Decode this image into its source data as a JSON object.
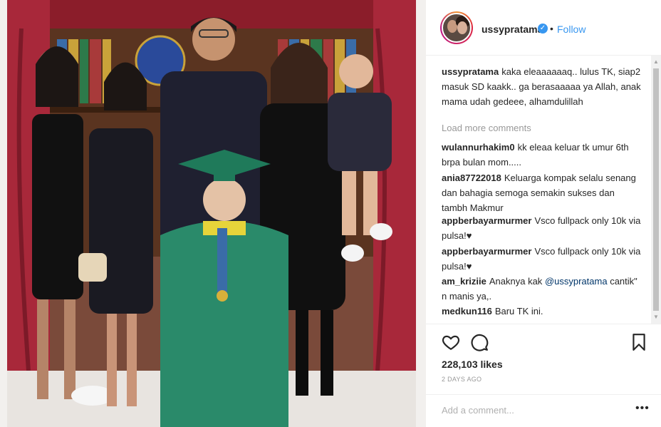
{
  "post": {
    "username": "ussypratama",
    "verified_icon": "verified-badge-icon",
    "follow_label": "Follow",
    "separator": "•"
  },
  "comments": [
    {
      "user": "ussypratama",
      "text": "kaka eleaaaaaaq.. lulus TK, siap2 masuk SD kaakk.. ga berasaaaaa ya Allah, anak mama udah gedeee, alhamdulillah"
    },
    {
      "user": "wulannurhakim0",
      "text": "kk eleaa keluar tk umur 6th brpa bulan mom....."
    },
    {
      "user": "ania87722018",
      "text": "Keluarga kompak selalu senang dan bahagia semoga semakin sukses dan tambh Makmur"
    },
    {
      "user": "appberbayarmurmer",
      "text": "Vsco fullpack only 10k via pulsa!♥"
    },
    {
      "user": "appberbayarmurmer",
      "text": "Vsco fullpack only 10k via pulsa!♥"
    },
    {
      "user": "am_kriziie",
      "text_before": "Anaknya kak",
      "mention": "@ussypratama",
      "text_after": "cantik\" n manis ya,."
    },
    {
      "user": "medkun116",
      "text": "Baru TK ini."
    }
  ],
  "load_more_label": "Load more comments",
  "actions": {
    "like_icon": "heart-icon",
    "comment_icon": "comment-bubble-icon",
    "save_icon": "bookmark-icon",
    "likes_text": "228,103 likes",
    "time_ago": "2 DAYS AGO"
  },
  "add_comment": {
    "placeholder": "Add a comment...",
    "more_label": "•••"
  },
  "colors": {
    "link_blue": "#3897f0",
    "text": "#262626",
    "muted": "#999999",
    "border": "#efefef"
  }
}
